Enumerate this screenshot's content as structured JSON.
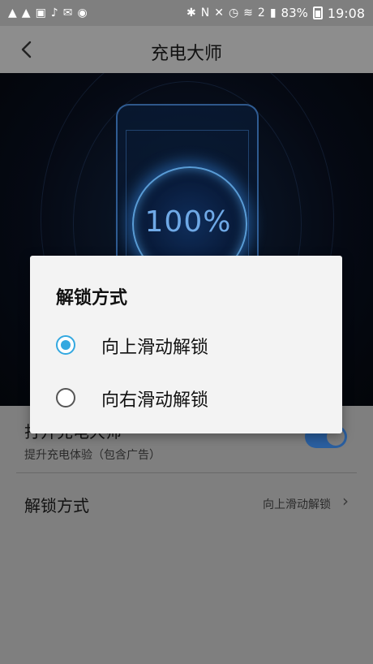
{
  "status_bar": {
    "left_icons": [
      "warning-icon",
      "warning-icon",
      "image-icon",
      "music-icon",
      "mail-icon",
      "notification-icon"
    ],
    "right_icons": [
      "bluetooth-icon",
      "nfc-icon",
      "mute-icon",
      "alarm-icon",
      "wifi-icon",
      "sim-2-icon",
      "signal-icon"
    ],
    "battery": "83%",
    "time": "19:08"
  },
  "app_bar": {
    "title": "充电大师"
  },
  "hero": {
    "charge_percent": "100%"
  },
  "settings": {
    "enable_row": {
      "title": "打开充电大师",
      "subtitle": "提升充电体验（包含广告）",
      "toggle_on": true
    },
    "unlock_row": {
      "title": "解锁方式",
      "value": "向上滑动解锁"
    }
  },
  "dialog": {
    "title": "解锁方式",
    "options": [
      {
        "label": "向上滑动解锁",
        "selected": true
      },
      {
        "label": "向右滑动解锁",
        "selected": false
      }
    ]
  },
  "colors": {
    "accent": "#33a8e0",
    "toggle": "#2a5fa0",
    "scrim": "#7f7f7f"
  }
}
